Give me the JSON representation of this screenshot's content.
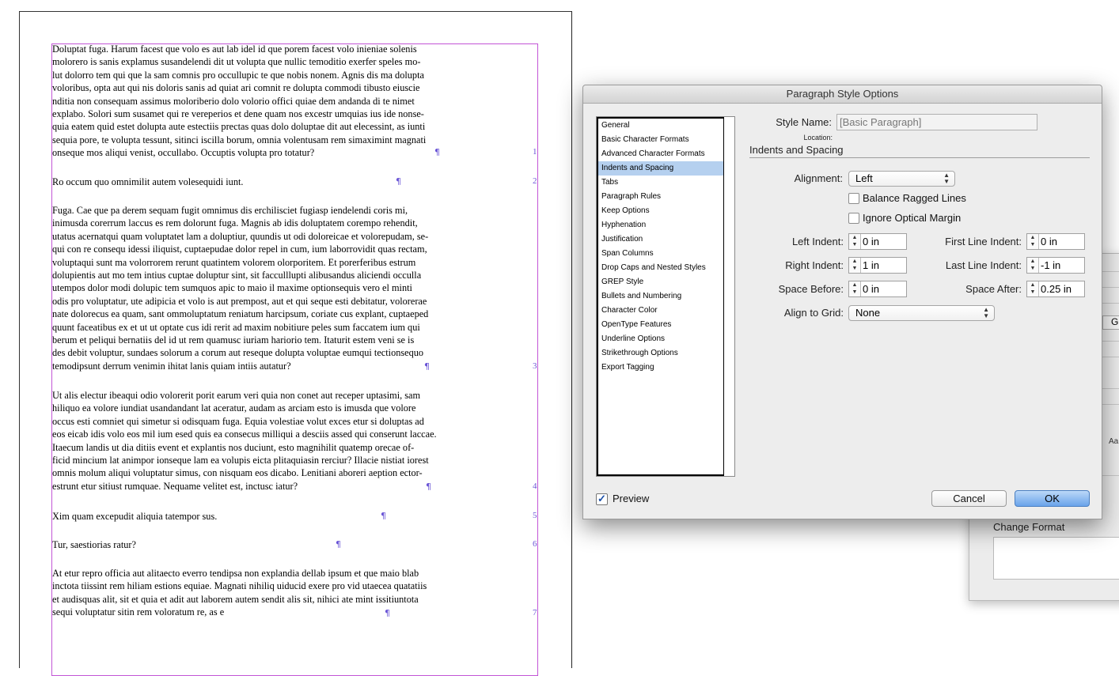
{
  "document": {
    "paragraphs": [
      {
        "lines": [
          "Doluptat fuga. Harum facest que volo es aut lab idel id que porem facest volo inieniae solenis",
          "molorero is sanis explamus susandelendi dit ut volupta que nullic temoditio exerfer speles mo-",
          "lut dolorro tem qui que la sam comnis pro occullupic te que nobis nonem. Agnis dis ma dolupta",
          "voloribus, opta aut qui nis doloris sanis ad quiat ari comnit re dolupta commodi tibusto eiuscie",
          "nditia non consequam assimus moloriberio dolo volorio offici quiae dem andanda di te nimet",
          "explabo. Solori sum susamet qui re vereperios et dene quam nos excestr umquias ius ide nonse-",
          "quia eatem quid estet dolupta aute estectiis prectas quas dolo doluptae dit aut elecessint, as iunti",
          "sequia pore, te volupta tessunt, sitinci iscilla borum, omnia volentusam rem simaximint magnati",
          "onseque mos aliqui venist, occullabo. Occuptis volupta pro totatur?"
        ],
        "number": "1"
      },
      {
        "lines": [
          "Ro occum quo omnimilit autem volesequidi iunt."
        ],
        "number": "2"
      },
      {
        "lines": [
          "Fuga. Cae que pa derem sequam fugit omnimus dis erchilisciet fugiasp iendelendi coris mi,",
          "inimusda corerrum laccus es rem dolorunt fuga. Magnis ab idis doluptatem corempo rehendit,",
          "utatus acernatqui quam voluptatet lam a doluptiur, quundis ut odi doloreicae et volorepudam, se-",
          "qui con re consequ idessi iliquist, cuptaepudae dolor repel in cum, ium laborrovidit quas rectam,",
          "voluptaqui sunt ma volorrorem rerunt quatintem volorem olorporitem. Et porerferibus estrum",
          "dolupientis aut mo tem intius cuptae doluptur sint, sit facculllupti alibusandus aliciendi occulla",
          "utempos dolor modi dolupic tem sumquos apic to maio il maxime optionsequis vero el minti",
          "odis pro voluptatur, ute adipicia et volo is aut prempost, aut et qui seque esti debitatur, volorerae",
          "nate dolorecus ea quam, sant ommoluptatum reniatum harcipsum, coriate cus explant, cuptaeped",
          "quunt faceatibus ex et ut ut optate cus idi rerit ad maxim nobitiure peles sum faccatem ium qui",
          "berum et peliqui bernatiis del id ut rem quamusc iuriam hariorio tem. Itaturit estem veni se is",
          "des debit voluptur, sundaes solorum a corum aut reseque dolupta voluptae eumqui tectionsequo",
          "temodipsunt derrum venimin ihitat lanis quiam intiis autatur?"
        ],
        "number": "3"
      },
      {
        "lines": [
          "Ut alis electur ibeaqui odio volorerit porit earum veri quia non conet aut receper uptasimi, sam",
          "hiliquo ea volore iundiat usandandant lat aceratur, audam as arciam esto is imusda que volore",
          "occus esti comniet qui simetur si odisquam fuga. Equia volestiae volut exces etur si doluptas ad",
          "eos eicab idis volo eos mil ium esed quis ea consecus milliqui a desciis assed qui conserunt laccae.",
          "Itaecum landis ut dia ditiis event et explantis nos duciunt, esto magnihilit quatemp orecae of-",
          "ficid mincium lat animpor ionseque lam ea volupis eicta plitaquiasin rerciur? Illacie nistiat iorest",
          "omnis molum aliqui voluptatur simus, con nisquam eos dicabo. Lenitiani aboreri aeption ector-",
          "estrunt etur sitiust rumquae. Nequame velitet est, inctusc iatur?"
        ],
        "number": "4"
      },
      {
        "lines": [
          "Xim quam excepudit aliquia tatempor sus."
        ],
        "number": "5"
      },
      {
        "lines": [
          "Tur, saestiorias ratur?"
        ],
        "number": "6"
      },
      {
        "lines": [
          "At etur repro officia aut alitaecto everro tendipsa non explandia dellab ipsum et que maio blab",
          "inctota tiissint rem hiliam estions equiae. Magnati nihiliq uiducid exere pro vid utaecea quatatiis",
          "et audisquas alit, sit et quia et adit aut laborem autem sendit alis sit, nihici ate mint issitiuntota",
          "sequi voluptatur sitin rem voloratum re, as e"
        ],
        "number": "7"
      }
    ]
  },
  "background_dialog": {
    "change_format_label": "Change Format",
    "gl_label": "Gl",
    "aa_label": "Aa"
  },
  "dialog": {
    "title": "Paragraph Style Options",
    "categories": [
      "General",
      "Basic Character Formats",
      "Advanced Character Formats",
      "Indents and Spacing",
      "Tabs",
      "Paragraph Rules",
      "Keep Options",
      "Hyphenation",
      "Justification",
      "Span Columns",
      "Drop Caps and Nested Styles",
      "GREP Style",
      "Bullets and Numbering",
      "Character Color",
      "OpenType Features",
      "Underline Options",
      "Strikethrough Options",
      "Export Tagging"
    ],
    "selected_category": "Indents and Spacing",
    "style_name_label": "Style Name:",
    "style_name_value": "[Basic Paragraph]",
    "location_label": "Location:",
    "section_title": "Indents and Spacing",
    "alignment_label": "Alignment:",
    "alignment_value": "Left",
    "balance_ragged_label": "Balance Ragged Lines",
    "balance_ragged_checked": false,
    "ignore_optical_label": "Ignore Optical Margin",
    "ignore_optical_checked": false,
    "left_indent_label": "Left Indent:",
    "left_indent_value": "0 in",
    "first_line_indent_label": "First Line Indent:",
    "first_line_indent_value": "0 in",
    "right_indent_label": "Right Indent:",
    "right_indent_value": "1 in",
    "last_line_indent_label": "Last Line Indent:",
    "last_line_indent_value": "-1 in",
    "space_before_label": "Space Before:",
    "space_before_value": "0 in",
    "space_after_label": "Space After:",
    "space_after_value": "0.25 in",
    "align_to_grid_label": "Align to Grid:",
    "align_to_grid_value": "None",
    "preview_label": "Preview",
    "preview_checked": true,
    "cancel_label": "Cancel",
    "ok_label": "OK"
  },
  "colors": {
    "frame": "#c255d6",
    "selection": "#b5d0ef",
    "ok_button": "#69a3ea"
  }
}
